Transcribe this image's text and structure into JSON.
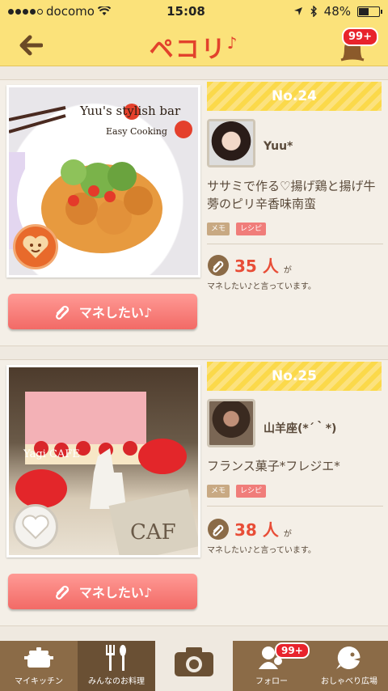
{
  "status_bar": {
    "carrier": "docomo",
    "time": "15:08",
    "battery": "48%",
    "battery_level": 0.48
  },
  "nav": {
    "logo": "ペコリ",
    "notification_badge": "99+"
  },
  "cards": [
    {
      "rank": "No.24",
      "photo_title": "Yuu's stylish bar",
      "photo_subtitle": "Easy Cooking",
      "user_name": "Yuu*",
      "recipe_title": "ササミで作る♡揚げ鶏と揚げ牛蒡のピリ辛香味南蛮",
      "tags": [
        "メモ",
        "レシピ"
      ],
      "count": "35",
      "count_unit": "人",
      "count_suffix": "が",
      "count_desc": "マネしたい♪と言っています。",
      "button_label": "マネしたい♪",
      "heart_state": "active"
    },
    {
      "rank": "No.25",
      "photo_title": "Yagi CAFE",
      "photo_subtitle": "",
      "user_name": "山羊座(*´｀*)",
      "recipe_title": "フランス菓子*フレジエ*",
      "tags": [
        "メモ",
        "レシピ"
      ],
      "count": "38",
      "count_unit": "人",
      "count_suffix": "が",
      "count_desc": "マネしたい♪と言っています。",
      "button_label": "マネしたい♪",
      "heart_state": "inactive"
    }
  ],
  "tabbar": {
    "tabs": [
      {
        "label": "マイキッチン",
        "icon": "pot-icon"
      },
      {
        "label": "みんなのお料理",
        "icon": "cutlery-icon"
      },
      {
        "label": "",
        "icon": "camera-icon"
      },
      {
        "label": "フォロー",
        "icon": "follow-icon",
        "badge": "99+"
      },
      {
        "label": "おしゃべり広場",
        "icon": "chat-icon"
      }
    ]
  },
  "colors": {
    "header": "#fbe27a",
    "accent_red": "#e84d37",
    "button": "#f26a66",
    "tabbar": "#8b6b47"
  }
}
